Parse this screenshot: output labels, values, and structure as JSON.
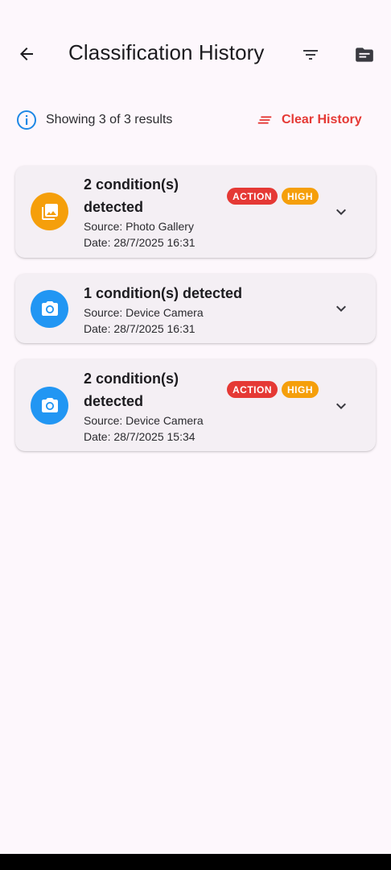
{
  "appbar": {
    "title": "Classification History",
    "back_icon": "arrow-back-icon",
    "filter_icon": "filter-icon",
    "folder_icon": "folder-icon"
  },
  "results": {
    "count_text": "Showing 3 of 3 results",
    "clear_label": "Clear History"
  },
  "colors": {
    "accent_red": "#e53935",
    "accent_orange": "#f59f0b",
    "camera_blue": "#2196f3",
    "gallery_orange": "#f59f0b",
    "info_blue": "#1e88e5"
  },
  "history": [
    {
      "headline_line1": "2 condition(s)",
      "headline_line2": "detected",
      "source": "Source: Photo Gallery",
      "date": "Date: 28/7/2025 16:31",
      "icon": "photo-library-icon",
      "badges": [
        "ACTION",
        "HIGH"
      ]
    },
    {
      "headline_line1": "1 condition(s) detected",
      "source": "Source: Device Camera",
      "date": "Date: 28/7/2025 16:31",
      "icon": "camera-icon",
      "badges": []
    },
    {
      "headline_line1": "2 condition(s)",
      "headline_line2": "detected",
      "source": "Source: Device Camera",
      "date": "Date: 28/7/2025 15:34",
      "icon": "camera-icon",
      "badges": [
        "ACTION",
        "HIGH"
      ]
    }
  ]
}
